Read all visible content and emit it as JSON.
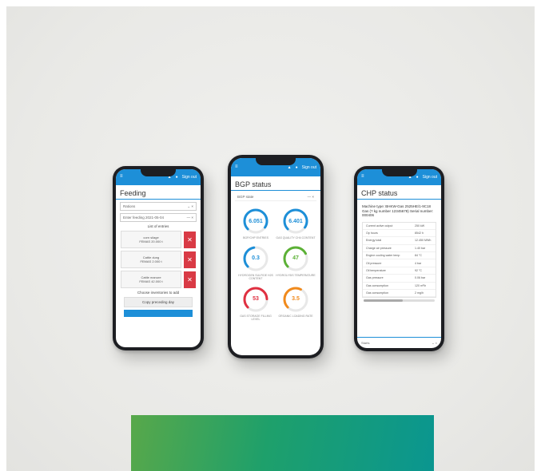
{
  "colors": {
    "accent": "#1d8fd8",
    "delete": "#d93a45",
    "gauge_blue": "#1d8fd8",
    "gauge_green": "#5cb136",
    "gauge_red": "#e03041",
    "gauge_orange": "#f18a1c"
  },
  "topbar": {
    "signout_label": "Sign out"
  },
  "feeding": {
    "title": "Feeding",
    "select_value": "Rations",
    "entry_value": "Enter feeding 2021-05-04",
    "list_header": "List of entries",
    "items": [
      {
        "name": "corn silage",
        "value": "FEMAS 20.000 t"
      },
      {
        "name": "Cattle dung",
        "value": "FEMAS 2.000 t"
      },
      {
        "name": "Cattle manure",
        "value": "FEMAS 42.000 t"
      }
    ],
    "choose_label": "Choose inventories to add",
    "copy_button": "Copy preceding day"
  },
  "bgp": {
    "title": "BGP status",
    "panel_label": "BGP state",
    "gauges": [
      {
        "value": "6.051",
        "color": "#1d8fd8",
        "fill": 0.72,
        "label": "BGP/CHP ENTRIES"
      },
      {
        "value": "6.401",
        "color": "#1d8fd8",
        "fill": 0.72,
        "label": "GAS QUALITY CH4 CONTENT"
      },
      {
        "value": "0.3",
        "color": "#1d8fd8",
        "fill": 0.35,
        "label": "HYDROGEN SULFIDE H2S CONTENT"
      },
      {
        "value": "47",
        "color": "#5cb136",
        "fill": 0.55,
        "label": "HYDROLYSIS TEMPERATURE"
      },
      {
        "value": "53",
        "color": "#e03041",
        "fill": 0.62,
        "label": "GAS STORAGE FILLING LEVEL"
      },
      {
        "value": "3.5",
        "color": "#f18a1c",
        "fill": 0.45,
        "label": "ORGANIC LOADING RATE"
      }
    ]
  },
  "chp": {
    "title": "CHP status",
    "info": "Machine type: BHKW-Gas 2525HE/1-9C18 Gas (? kg number 12345678) Serial number: 000406",
    "rows": [
      {
        "label": "Current active output",
        "value": "250 kW"
      },
      {
        "label": "Op hours",
        "value": "8542 h"
      },
      {
        "label": "Energy total",
        "value": "12.450 MWh"
      },
      {
        "label": "Charge air pressure",
        "value": "1.40 bar"
      },
      {
        "label": "Engine cooling water temp",
        "value": "84 °C"
      },
      {
        "label": "Oil pressure",
        "value": "4 bar"
      },
      {
        "label": "Oil temperature",
        "value": "92 °C"
      },
      {
        "label": "Gas pressure",
        "value": "0.06 bar"
      },
      {
        "label": "Gas consumption",
        "value": "120 m³/h"
      },
      {
        "label": "Gas consumption",
        "value": "2 mg/h"
      }
    ],
    "footer_select": "Starts"
  }
}
